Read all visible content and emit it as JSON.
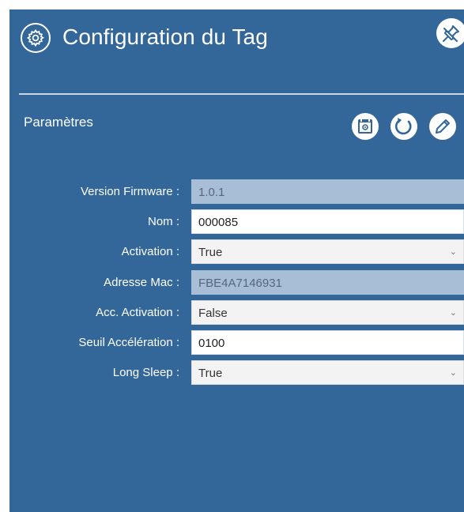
{
  "header": {
    "title": "Configuration du Tag",
    "settings_icon": "gear-icon",
    "unpin_icon": "unpin-icon"
  },
  "section": {
    "title": "Paramètres",
    "toolbar": [
      {
        "icon": "calendar-settings-icon"
      },
      {
        "icon": "refresh-icon"
      },
      {
        "icon": "edit-pencil-icon"
      }
    ]
  },
  "form": {
    "fields": [
      {
        "label": "Version Firmware :",
        "value": "1.0.1",
        "type": "readonly"
      },
      {
        "label": "Nom :",
        "value": "000085",
        "type": "text"
      },
      {
        "label": "Activation :",
        "value": "True",
        "type": "select"
      },
      {
        "label": "Adresse Mac :",
        "value": "FBE4A7146931",
        "type": "readonly"
      },
      {
        "label": "Acc. Activation :",
        "value": "False",
        "type": "select"
      },
      {
        "label": "Seuil Accélération :",
        "value": "0100",
        "type": "text"
      },
      {
        "label": "Long Sleep :",
        "value": "True",
        "type": "select"
      }
    ]
  },
  "colors": {
    "panel_bg": "#336699",
    "readonly_bg": "#a8bdd6",
    "text_white": "#ffffff"
  }
}
